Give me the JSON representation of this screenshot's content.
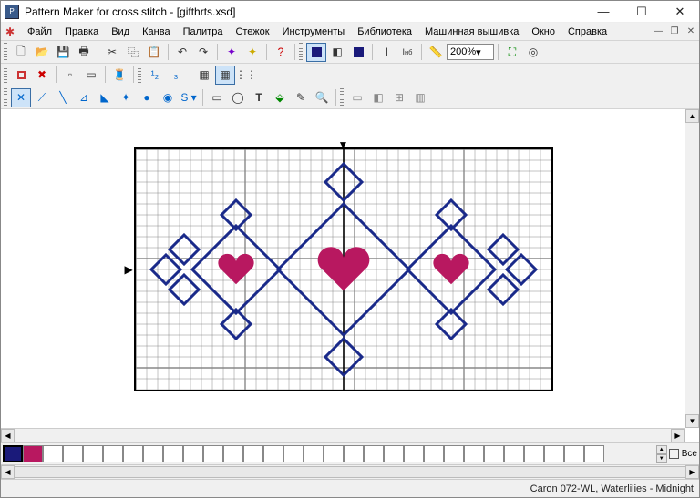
{
  "title": "Pattern Maker for cross stitch - [gifthrts.xsd]",
  "menu": {
    "items": [
      "Файл",
      "Правка",
      "Вид",
      "Канва",
      "Палитра",
      "Стежок",
      "Инструменты",
      "Библиотека",
      "Машинная вышивка",
      "Окно",
      "Справка"
    ]
  },
  "zoom": "200%",
  "palette": {
    "all_label": "Все"
  },
  "status": {
    "thread": "Caron  072-WL, Waterlilies - Midnight"
  },
  "canvas": {
    "cols": 38,
    "rows": 22,
    "cell": 12
  },
  "winbuttons": {
    "min": "—",
    "max": "☐",
    "close": "✕"
  },
  "mdi": {
    "min": "—",
    "restore": "❐",
    "close": "✕"
  }
}
